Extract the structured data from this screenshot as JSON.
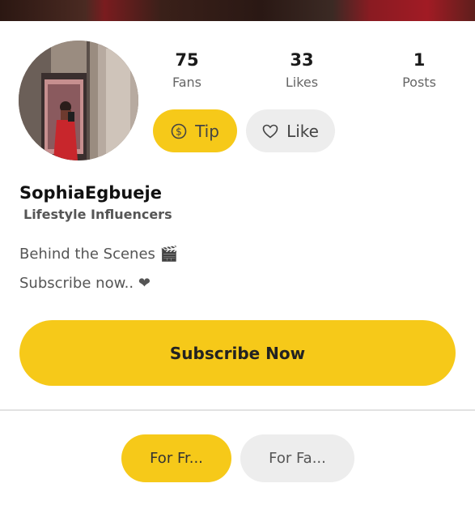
{
  "profile": {
    "username": "SophiaEgbueje",
    "category": "Lifestyle Influencers",
    "avatar_icon": "profile-photo"
  },
  "stats": [
    {
      "value": "75",
      "label": "Fans"
    },
    {
      "value": "33",
      "label": "Likes"
    },
    {
      "value": "1",
      "label": "Posts"
    }
  ],
  "actions": {
    "tip_label": "Tip",
    "tip_icon": "dollar-coin-icon",
    "like_label": "Like",
    "like_icon": "heart-outline-icon"
  },
  "bio": {
    "line1": "Behind the Scenes 🎬",
    "line2": "Subscribe now.. ❤"
  },
  "subscribe": {
    "label": "Subscribe Now"
  },
  "tabs": [
    {
      "label": "For Fr..."
    },
    {
      "label": "For Fa..."
    }
  ],
  "colors": {
    "accent": "#f6c919",
    "secondary_button": "#ededed",
    "text_primary": "#111111",
    "text_secondary": "#666666"
  }
}
